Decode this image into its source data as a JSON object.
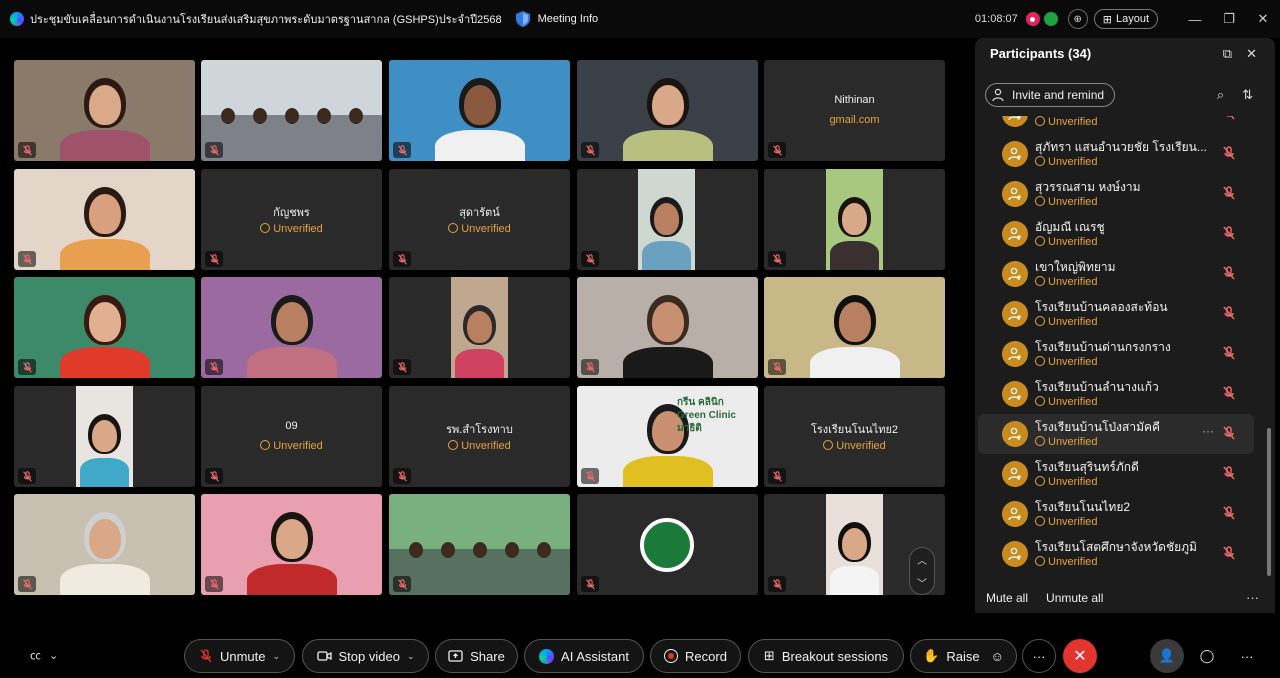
{
  "titlebar": {
    "meeting_title": "ประชุมขับเคลื่อนการดำเนินงานโรงเรียนส่งเสริมสุขภาพระดับมาตรฐานสากล (GSHPS)ประจำปี2568",
    "meeting_info": "Meeting Info",
    "timer": "01:08:07",
    "layout_label": "Layout"
  },
  "tiles": [
    {
      "name": "",
      "sub": ""
    },
    {
      "name": "",
      "sub": ""
    },
    {
      "name": "",
      "sub": ""
    },
    {
      "name": "",
      "sub": ""
    },
    {
      "name": "Nithinan",
      "sub": "gmail.com"
    },
    {
      "name": "",
      "sub": ""
    },
    {
      "name": "กัญชพร",
      "sub": "Unverified"
    },
    {
      "name": "สุดารัตน์",
      "sub": "Unverified"
    },
    {
      "name": "",
      "sub": ""
    },
    {
      "name": "",
      "sub": ""
    },
    {
      "name": "",
      "sub": ""
    },
    {
      "name": "",
      "sub": ""
    },
    {
      "name": "",
      "sub": ""
    },
    {
      "name": "",
      "sub": ""
    },
    {
      "name": "",
      "sub": ""
    },
    {
      "name": "",
      "sub": ""
    },
    {
      "name": "09",
      "sub": "Unverified"
    },
    {
      "name": "รพ.สำโรงทาบ",
      "sub": "Unverified"
    },
    {
      "name": "",
      "sub": ""
    },
    {
      "name": "โรงเรียนโนนไทย2",
      "sub": "Unverified"
    }
  ],
  "tile_overlay_text": {
    "clinic_sign_line1": "กรีน คลินิก",
    "clinic_sign_line2": "Green Clinic",
    "clinic_sign_line3": "มาธิติ"
  },
  "participants_panel": {
    "title": "Participants (34)",
    "invite_label": "Invite and remind",
    "mute_all": "Mute all",
    "unmute_all": "Unmute all",
    "items": [
      {
        "name": "",
        "status": "Unverified"
      },
      {
        "name": "สุภัทรา แสนอำนวยชัย โรงเรียน...",
        "status": "Unverified"
      },
      {
        "name": "สุวรรณสาม หงษ์งาม",
        "status": "Unverified"
      },
      {
        "name": "อัญมณี เณรชู",
        "status": "Unverified"
      },
      {
        "name": "เขาใหญ่พิทยาม",
        "status": "Unverified"
      },
      {
        "name": "โรงเรียนบ้านคลองสะท้อน",
        "status": "Unverified"
      },
      {
        "name": "โรงเรียนบ้านด่านกรงกราง",
        "status": "Unverified"
      },
      {
        "name": "โรงเรียนบ้านลำนางแก้ว",
        "status": "Unverified"
      },
      {
        "name": "โรงเรียนบ้านโป่งสามัคคี",
        "status": "Unverified"
      },
      {
        "name": "โรงเรียนสุรินทร์ภักดี",
        "status": "Unverified"
      },
      {
        "name": "โรงเรียนโนนไทย2",
        "status": "Unverified"
      },
      {
        "name": "โรงเรียนโสตศึกษาจังหวัดชัยภูมิ",
        "status": "Unverified"
      }
    ]
  },
  "toolbar": {
    "unmute": "Unmute",
    "stop_video": "Stop video",
    "share": "Share",
    "ai_assistant": "AI Assistant",
    "record": "Record",
    "breakout": "Breakout sessions",
    "raise": "Raise"
  },
  "colors": {
    "unverified": "#e8a33a",
    "end_call": "#e2352f",
    "avatar": "#c98a1e",
    "record": "#e0245e"
  }
}
